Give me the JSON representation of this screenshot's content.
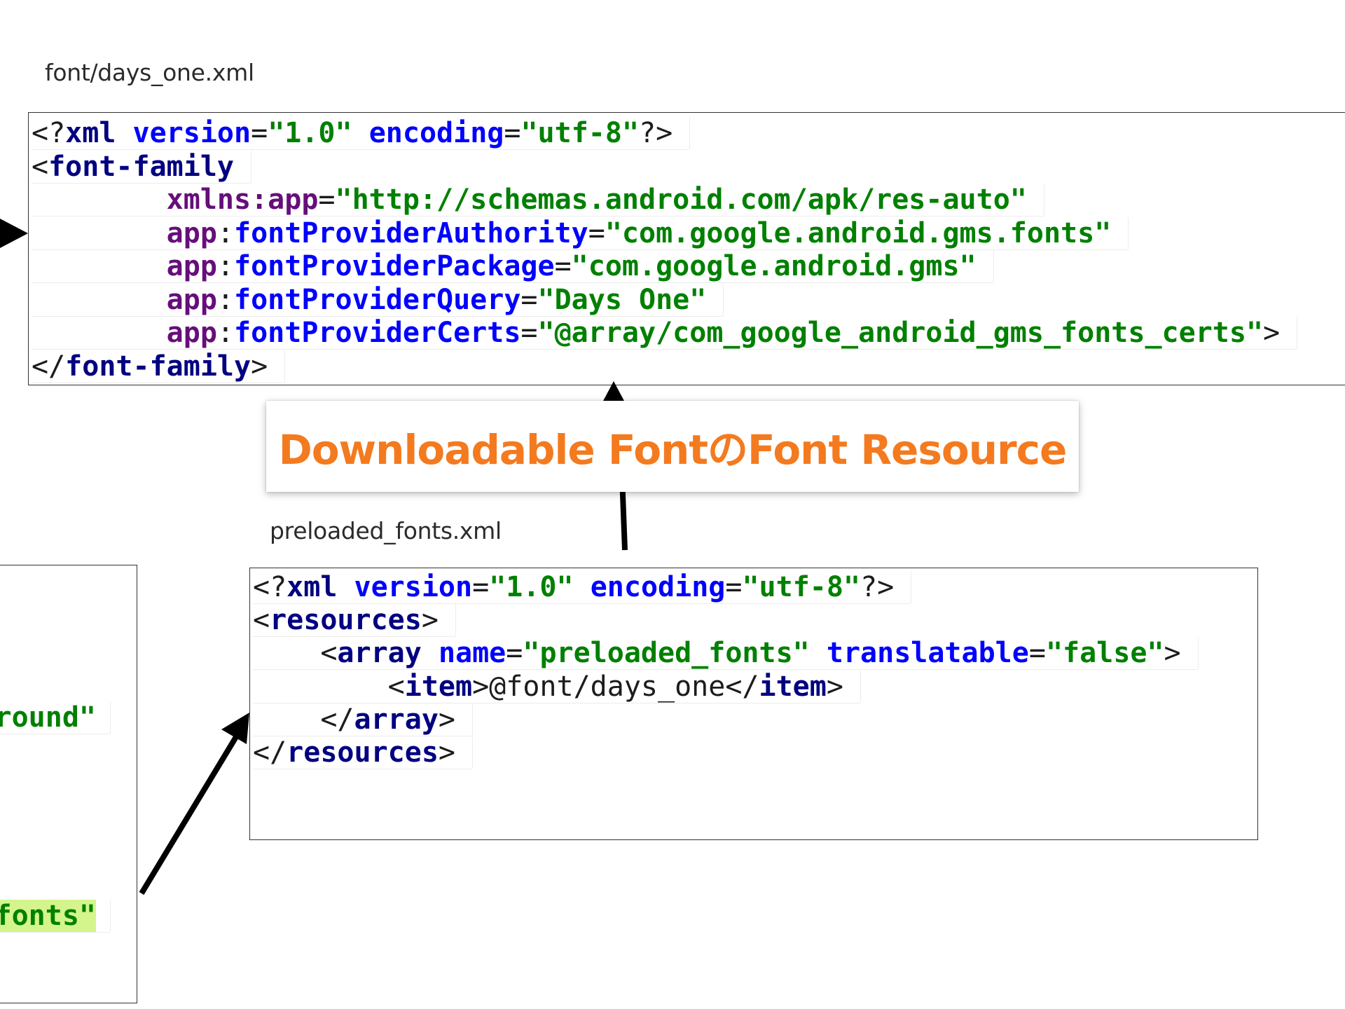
{
  "title": {
    "text": "Downloadable FontのFont Resource",
    "color": "#f47a1f"
  },
  "top_file": {
    "label": "font/days_one.xml",
    "lines": [
      [
        [
          "t-punc",
          "<?"
        ],
        [
          "t-tag",
          "xml"
        ],
        [
          "t-text",
          " "
        ],
        [
          "t-attr",
          "version"
        ],
        [
          "t-punc",
          "="
        ],
        [
          "t-val",
          "\"1.0\""
        ],
        [
          "t-text",
          " "
        ],
        [
          "t-attr",
          "encoding"
        ],
        [
          "t-punc",
          "="
        ],
        [
          "t-val",
          "\"utf-8\""
        ],
        [
          "t-punc",
          "?>"
        ]
      ],
      [
        [
          "t-punc",
          "<"
        ],
        [
          "t-tag",
          "font-family"
        ]
      ],
      [
        [
          "t-text",
          "        "
        ],
        [
          "t-ns",
          "xmlns:app"
        ],
        [
          "t-punc",
          "="
        ],
        [
          "t-val",
          "\"http://schemas.android.com/apk/res-auto\""
        ]
      ],
      [
        [
          "t-text",
          "        "
        ],
        [
          "t-ns",
          "app"
        ],
        [
          "t-punc",
          ":"
        ],
        [
          "t-attr",
          "fontProviderAuthority"
        ],
        [
          "t-punc",
          "="
        ],
        [
          "t-val",
          "\"com.google.android.gms.fonts\""
        ]
      ],
      [
        [
          "t-text",
          "        "
        ],
        [
          "t-ns",
          "app"
        ],
        [
          "t-punc",
          ":"
        ],
        [
          "t-attr",
          "fontProviderPackage"
        ],
        [
          "t-punc",
          "="
        ],
        [
          "t-val",
          "\"com.google.android.gms\""
        ]
      ],
      [
        [
          "t-text",
          "        "
        ],
        [
          "t-ns",
          "app"
        ],
        [
          "t-punc",
          ":"
        ],
        [
          "t-attr",
          "fontProviderQuery"
        ],
        [
          "t-punc",
          "="
        ],
        [
          "t-val",
          "\"Days One\""
        ]
      ],
      [
        [
          "t-text",
          "        "
        ],
        [
          "t-ns",
          "app"
        ],
        [
          "t-punc",
          ":"
        ],
        [
          "t-attr",
          "fontProviderCerts"
        ],
        [
          "t-punc",
          "="
        ],
        [
          "t-val",
          "\"@array/com_google_android_gms_fonts_certs\""
        ],
        [
          "t-punc",
          ">"
        ]
      ],
      [
        [
          "t-punc",
          "</"
        ],
        [
          "t-tag",
          "font-family"
        ],
        [
          "t-punc",
          ">"
        ]
      ]
    ]
  },
  "bottom_file": {
    "label": "preloaded_fonts.xml",
    "lines": [
      [
        [
          "t-punc",
          "<?"
        ],
        [
          "t-tag",
          "xml"
        ],
        [
          "t-text",
          " "
        ],
        [
          "t-attr",
          "version"
        ],
        [
          "t-punc",
          "="
        ],
        [
          "t-val",
          "\"1.0\""
        ],
        [
          "t-text",
          " "
        ],
        [
          "t-attr",
          "encoding"
        ],
        [
          "t-punc",
          "="
        ],
        [
          "t-val",
          "\"utf-8\""
        ],
        [
          "t-punc",
          "?>"
        ]
      ],
      [
        [
          "t-punc",
          "<"
        ],
        [
          "t-tag",
          "resources"
        ],
        [
          "t-punc",
          ">"
        ]
      ],
      [
        [
          "t-text",
          "    "
        ],
        [
          "t-punc",
          "<"
        ],
        [
          "t-tag",
          "array"
        ],
        [
          "t-text",
          " "
        ],
        [
          "t-attr",
          "name"
        ],
        [
          "t-punc",
          "="
        ],
        [
          "t-val",
          "\"preloaded_fonts\""
        ],
        [
          "t-text",
          " "
        ],
        [
          "t-attr",
          "translatable"
        ],
        [
          "t-punc",
          "="
        ],
        [
          "t-val",
          "\"false\""
        ],
        [
          "t-punc",
          ">"
        ]
      ],
      [
        [
          "t-text",
          "        "
        ],
        [
          "t-punc",
          "<"
        ],
        [
          "t-tag",
          "item"
        ],
        [
          "t-punc",
          ">"
        ],
        [
          "t-text",
          "@font/days_one"
        ],
        [
          "t-punc",
          "</"
        ],
        [
          "t-tag",
          "item"
        ],
        [
          "t-punc",
          ">"
        ]
      ],
      [
        [
          "t-text",
          "    "
        ],
        [
          "t-punc",
          "</"
        ],
        [
          "t-tag",
          "array"
        ],
        [
          "t-punc",
          ">"
        ]
      ],
      [
        [
          "t-punc",
          "</"
        ],
        [
          "t-tag",
          "resources"
        ],
        [
          "t-punc",
          ">"
        ]
      ]
    ]
  },
  "left_file": {
    "lines": [
      [
        [
          "t-val",
          "round\""
        ]
      ],
      [
        [
          "t-val t-hi",
          "fonts\""
        ]
      ]
    ]
  }
}
